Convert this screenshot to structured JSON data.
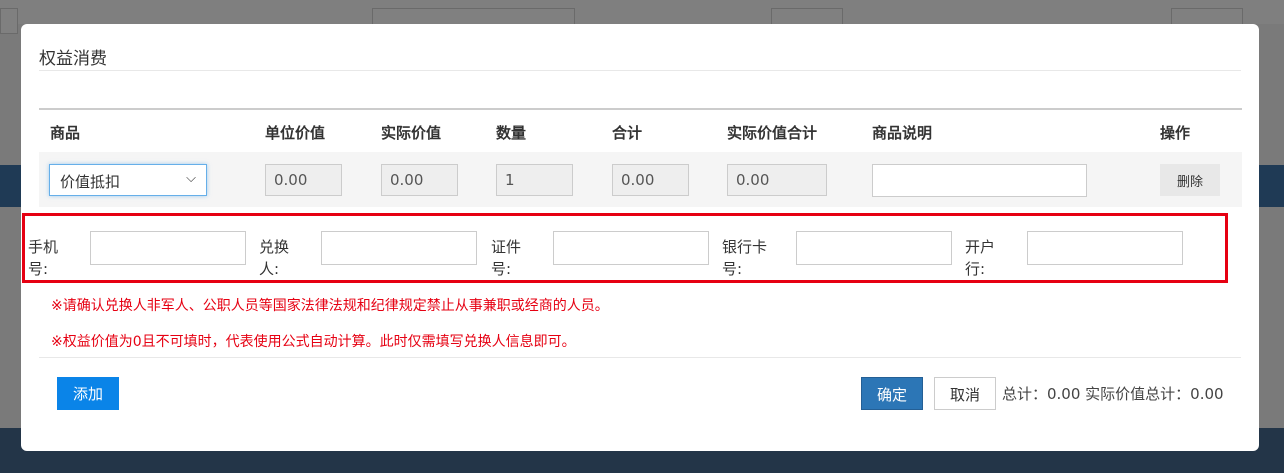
{
  "dialog": {
    "title": "权益消费"
  },
  "table": {
    "headers": [
      "商品",
      "单位价值",
      "实际价值",
      "数量",
      "合计",
      "实际价值合计",
      "商品说明",
      "操作"
    ],
    "row": {
      "product": "价值抵扣",
      "unit_value": "0.00",
      "actual_value": "0.00",
      "quantity": "1",
      "total": "0.00",
      "actual_total": "0.00",
      "description": "",
      "action": "删除"
    }
  },
  "form": {
    "phone_label": "手机号:",
    "redeemer_label": "兑换人:",
    "id_label": "证件号:",
    "bank_card_label": "银行卡号:",
    "bank_label": "开户行:"
  },
  "notes": [
    "※请确认兑换人非军人、公职人员等国家法律法规和纪律规定禁止从事兼职或经商的人员。",
    "※权益价值为0且不可填时，代表使用公式自动计算。此时仅需填写兑换人信息即可。"
  ],
  "footer": {
    "add": "添加",
    "confirm": "确定",
    "cancel": "取消",
    "totals": "总计：0.00 实际价值总计：0.00"
  },
  "colors": {
    "accent": "#0a84e8",
    "confirm": "#2c76b6",
    "warning": "#e60012"
  }
}
